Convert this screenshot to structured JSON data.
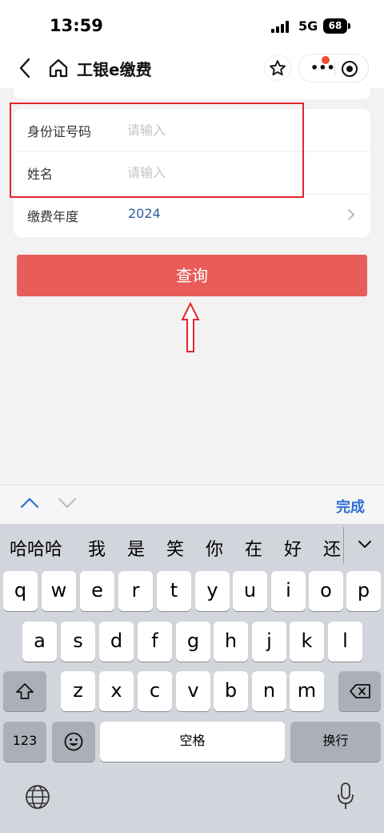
{
  "status_bar": {
    "time": "13:59",
    "network": "5G",
    "battery": "68"
  },
  "nav": {
    "title": "工银e缴费"
  },
  "form": {
    "rows": [
      {
        "label": "身份证号码",
        "placeholder": "请输入"
      },
      {
        "label": "姓名",
        "placeholder": "请输入"
      },
      {
        "label": "缴费年度",
        "value": "2024"
      }
    ],
    "submit_label": "查询"
  },
  "keyboard_toolbar": {
    "done_label": "完成"
  },
  "keyboard": {
    "candidates": [
      "哈哈哈",
      "我",
      "是",
      "笑",
      "你",
      "在",
      "好",
      "还"
    ],
    "row1": [
      "q",
      "w",
      "e",
      "r",
      "t",
      "y",
      "u",
      "i",
      "o",
      "p"
    ],
    "row2": [
      "a",
      "s",
      "d",
      "f",
      "g",
      "h",
      "j",
      "k",
      "l"
    ],
    "row3": [
      "z",
      "x",
      "c",
      "v",
      "b",
      "n",
      "m"
    ],
    "numbers_label": "123",
    "space_label": "空格",
    "return_label": "换行"
  }
}
